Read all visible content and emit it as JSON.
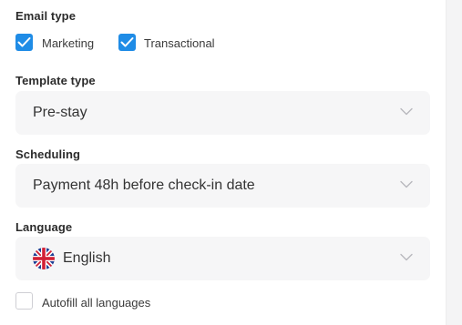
{
  "email_type": {
    "label": "Email type",
    "options": [
      {
        "label": "Marketing",
        "checked": true
      },
      {
        "label": "Transactional",
        "checked": true
      }
    ]
  },
  "template_type": {
    "label": "Template type",
    "value": "Pre-stay"
  },
  "scheduling": {
    "label": "Scheduling",
    "value": "Payment 48h before check-in date"
  },
  "language": {
    "label": "Language",
    "value": "English",
    "flag_icon": "uk-flag-icon"
  },
  "autofill": {
    "label": "Autofill all languages",
    "checked": false
  },
  "colors": {
    "checkbox_accent": "#1f8ce6",
    "select_background": "#f6f6f7"
  }
}
